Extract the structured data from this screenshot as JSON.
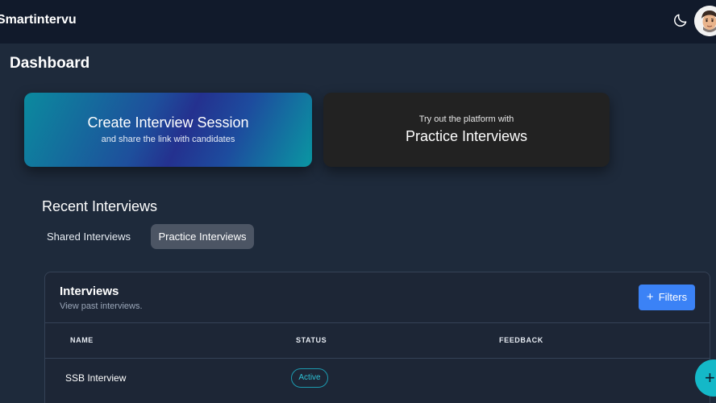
{
  "topbar": {
    "brand": "Smartintervu",
    "theme_icon": "moon-icon",
    "avatar_icon": "user-avatar"
  },
  "page": {
    "title": "Dashboard"
  },
  "cards": {
    "create": {
      "title": "Create Interview Session",
      "subtitle": "and share the link with candidates"
    },
    "practice": {
      "subtitle": "Try out the platform with",
      "title": "Practice Interviews"
    }
  },
  "recent": {
    "title": "Recent Interviews",
    "tabs": [
      {
        "label": "Shared Interviews",
        "active": false
      },
      {
        "label": "Practice Interviews",
        "active": true
      }
    ]
  },
  "interviews": {
    "title": "Interviews",
    "subtitle": "View past interviews.",
    "filters_icon": "+",
    "filters_label": "Filters",
    "columns": [
      "NAME",
      "STATUS",
      "FEEDBACK"
    ],
    "rows": [
      {
        "name": "SSB Interview",
        "status": "Active",
        "feedback": ""
      }
    ]
  },
  "fab": {
    "icon": "+"
  },
  "colors": {
    "background": "#1e2a3b",
    "topbar": "#111a2b",
    "accent_blue": "#3b82f6",
    "accent_teal": "#14b8c8"
  }
}
